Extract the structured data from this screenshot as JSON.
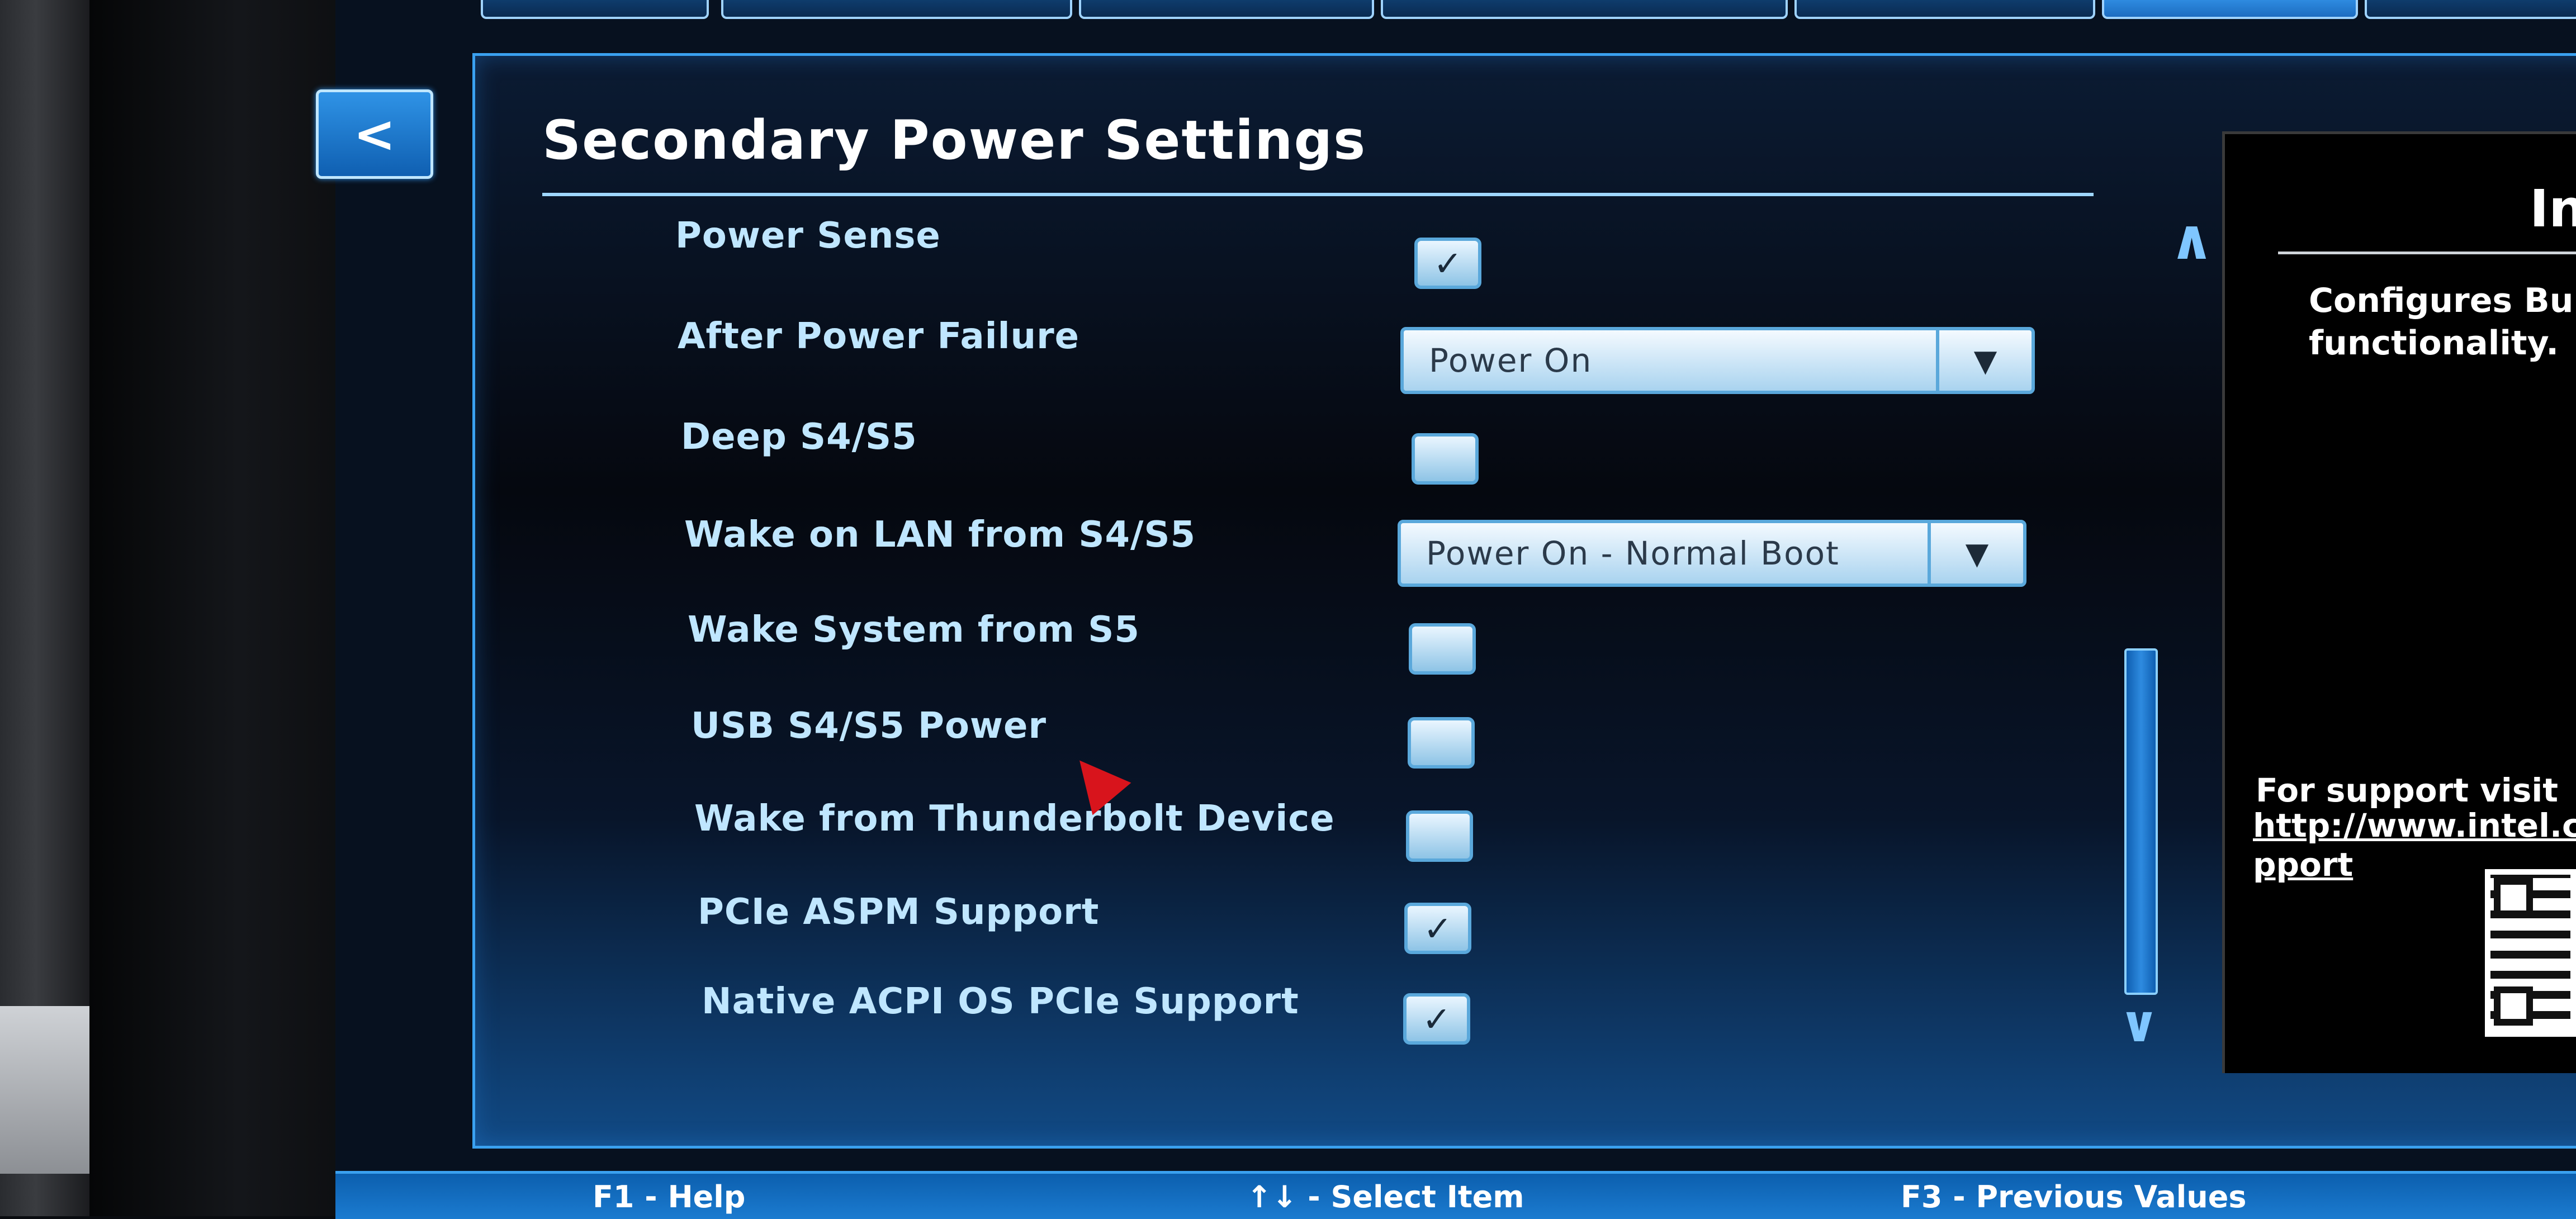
{
  "screen": {
    "title": "Secondary Power Settings",
    "back_label": "<"
  },
  "settings": [
    {
      "label": "Power Sense",
      "type": "checkbox",
      "checked": true
    },
    {
      "label": "After Power Failure",
      "type": "dropdown",
      "value": "Power On"
    },
    {
      "label": "Deep S4/S5",
      "type": "checkbox",
      "checked": false
    },
    {
      "label": "Wake on LAN from S4/S5",
      "type": "dropdown",
      "value": "Power On - Normal Boot"
    },
    {
      "label": "Wake System from S5",
      "type": "checkbox",
      "checked": false
    },
    {
      "label": "USB S4/S5 Power",
      "type": "checkbox",
      "checked": false
    },
    {
      "label": "Wake from Thunderbolt Device",
      "type": "checkbox",
      "checked": false
    },
    {
      "label": "PCIe ASPM Support",
      "type": "checkbox",
      "checked": true
    },
    {
      "label": "Native ACPI OS PCIe Support",
      "type": "checkbox",
      "checked": true
    }
  ],
  "check_glyph": "✓",
  "dropdown_arrow_glyph": "▼",
  "scroll": {
    "up_glyph": "∧",
    "down_glyph": "∨"
  },
  "info": {
    "title": "In",
    "description_line1": "Configures Bu",
    "description_line2": "functionality.",
    "support_text": "For support visit",
    "support_link_line1": "http://www.intel.c",
    "support_link_line2": "pport"
  },
  "footer": {
    "item1": "F1 - Help",
    "item2": "↑↓ - Select Item",
    "item3": "F3 - Previous Values"
  },
  "colors": {
    "accent": "#3aa1f0",
    "label_text": "#bfe6ff",
    "panel_bg": "#05080f"
  }
}
